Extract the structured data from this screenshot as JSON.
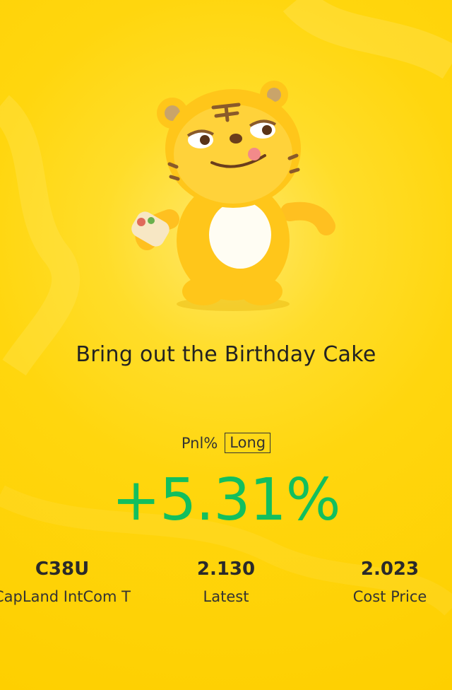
{
  "headline": "Bring out the Birthday Cake",
  "pnl": {
    "label": "Pnl%",
    "position_badge": "Long",
    "value": "+5.31%"
  },
  "stats": [
    {
      "value": "C38U",
      "label": "CapLand IntCom T"
    },
    {
      "value": "2.130",
      "label": "Latest"
    },
    {
      "value": "2.023",
      "label": "Cost Price"
    }
  ],
  "colors": {
    "background": "#fed400",
    "gain": "#12bf5e",
    "text": "#222222"
  },
  "mascot": "tiger-mascot-holding-food"
}
